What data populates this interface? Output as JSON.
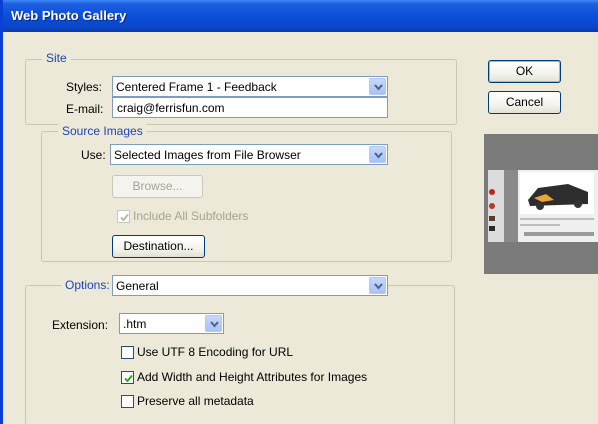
{
  "window": {
    "title": "Web Photo Gallery"
  },
  "site": {
    "legend": "Site",
    "styles_label": "Styles:",
    "styles_value": "Centered Frame 1 - Feedback",
    "email_label": "E-mail:",
    "email_value": "craig@ferrisfun.com"
  },
  "source": {
    "legend": "Source Images",
    "use_label": "Use:",
    "use_value": "Selected Images from File Browser",
    "browse_label": "Browse...",
    "include_subfolders_label": "Include All Subfolders",
    "include_subfolders_checked": true,
    "include_subfolders_enabled": false,
    "destination_label": "Destination..."
  },
  "options": {
    "legend": "Options:",
    "value": "General",
    "extension_label": "Extension:",
    "extension_value": ".htm",
    "checkboxes": [
      {
        "label": "Use UTF 8 Encoding for URL",
        "checked": false
      },
      {
        "label": "Add Width and Height Attributes for Images",
        "checked": true
      },
      {
        "label": "Preserve all metadata",
        "checked": false
      }
    ]
  },
  "buttons": {
    "ok": "OK",
    "cancel": "Cancel"
  },
  "icons": {
    "dropdown": "chevron-down-icon",
    "check": "checkmark-icon"
  },
  "colors": {
    "titlebar": "#0a4fd8",
    "dialog_bg": "#ece9d8",
    "legend_text": "#1e44b8",
    "border_accent": "#0a3fd6"
  }
}
